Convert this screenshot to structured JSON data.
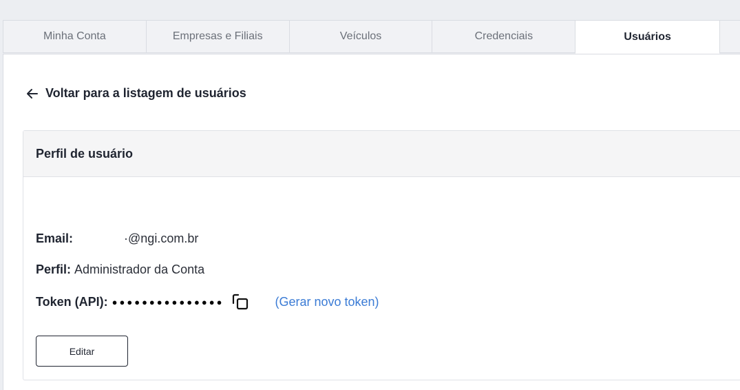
{
  "tabs": [
    {
      "label": "Minha Conta"
    },
    {
      "label": "Empresas e Filiais"
    },
    {
      "label": "Veículos"
    },
    {
      "label": "Credenciais"
    },
    {
      "label": "Usuários",
      "active": true
    }
  ],
  "back_link": {
    "label": "Voltar para a listagem de usuários",
    "icon": "arrow-left-icon"
  },
  "profile_card": {
    "title": "Perfil de usuário",
    "email_label": "Email:",
    "email_value": "·@ngi.com.br",
    "perfil_label": "Perfil:",
    "perfil_value": "Administrador da Conta",
    "token_label": "Token (API):",
    "token_value": "●●●●●●●●●●●●●●●",
    "copy_icon": "copy-icon",
    "generate_token_link": "(Gerar novo token)",
    "edit_button": "Editar"
  },
  "colors": {
    "link": "#3a7bd5",
    "text": "#1f2430",
    "background": "#eceef2"
  }
}
